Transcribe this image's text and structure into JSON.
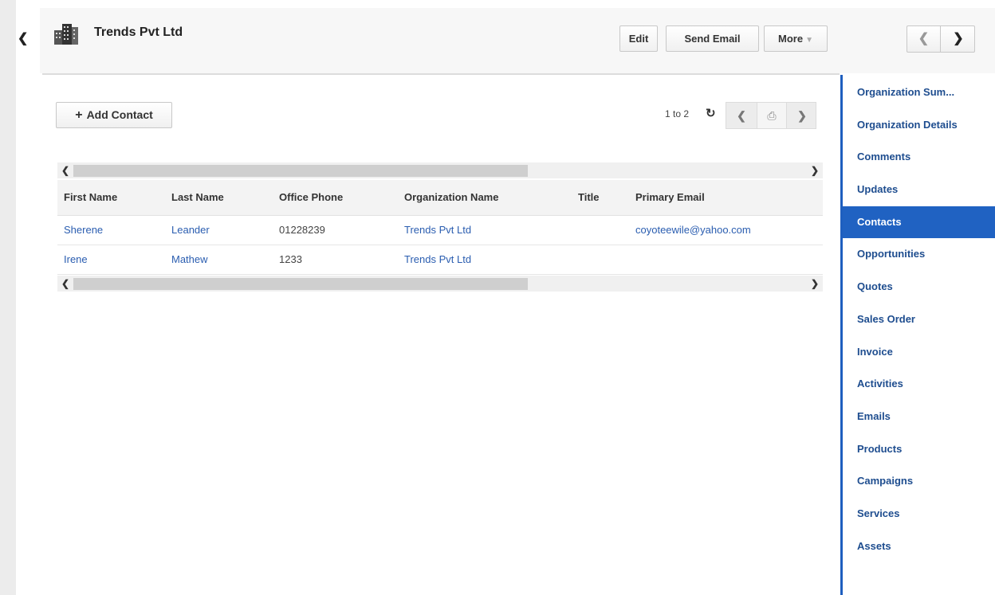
{
  "header": {
    "title": "Trends Pvt Ltd",
    "buttons": {
      "edit": "Edit",
      "send_email": "Send Email",
      "more": "More"
    }
  },
  "toolbar": {
    "add_contact": "Add Contact",
    "pager_text": "1 to 2"
  },
  "table": {
    "columns": [
      "First Name",
      "Last Name",
      "Office Phone",
      "Organization Name",
      "Title",
      "Primary Email"
    ],
    "rows": [
      [
        "Sherene",
        "Leander",
        "01228239",
        "Trends Pvt Ltd",
        "",
        "coyoteewile@yahoo.com"
      ],
      [
        "Irene",
        "Mathew",
        "1233",
        "Trends Pvt Ltd",
        "",
        ""
      ]
    ]
  },
  "sidebar": {
    "active": "Contacts",
    "items": [
      "Organization Sum...",
      "Organization Details",
      "Comments",
      "Updates",
      "Contacts",
      "Opportunities",
      "Quotes",
      "Sales Order",
      "Invoice",
      "Activities",
      "Emails",
      "Products",
      "Campaigns",
      "Services",
      "Assets"
    ]
  },
  "icons": {
    "collapse": "chevron-left-icon",
    "organization": "building-icon",
    "refresh": "refresh-icon",
    "prev": "chevron-left-icon",
    "next": "chevron-right-icon",
    "page_jump": "page-jump-icon"
  },
  "colors": {
    "accent": "#2062c2",
    "link": "#2a5db0",
    "sidebar_text": "#1e4d8f"
  }
}
